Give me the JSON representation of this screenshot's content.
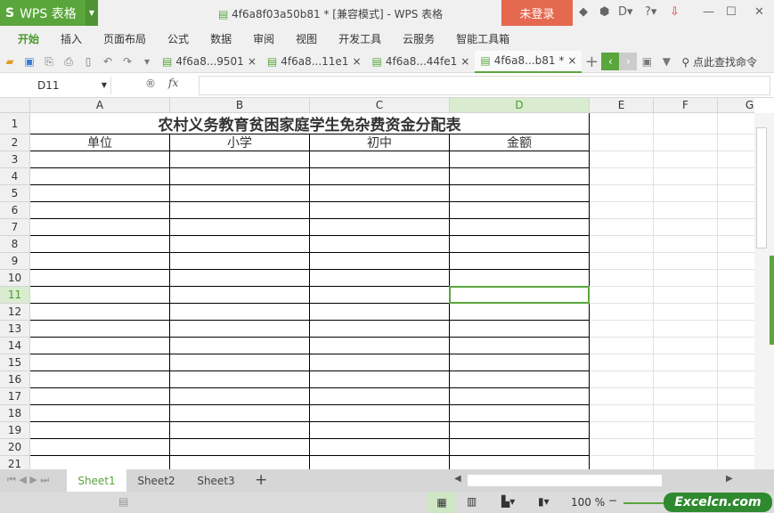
{
  "app": {
    "name": "WPS 表格",
    "title": "4f6a8f03a50b81 * [兼容模式] - WPS 表格",
    "login": "未登录"
  },
  "menu": [
    "开始",
    "插入",
    "页面布局",
    "公式",
    "数据",
    "审阅",
    "视图",
    "开发工具",
    "云服务",
    "智能工具箱"
  ],
  "doc_tabs": [
    {
      "label": "4f6a8...9501",
      "active": false
    },
    {
      "label": "4f6a8...11e1",
      "active": false
    },
    {
      "label": "4f6a8...44fe1",
      "active": false
    },
    {
      "label": "4f6a8...b81 *",
      "active": true
    }
  ],
  "search_label": "点此查找命令",
  "namebox": "D11",
  "fx": "fx",
  "columns": [
    "A",
    "B",
    "C",
    "D",
    "E",
    "F",
    "G"
  ],
  "selected_col": "D",
  "selected_row": 11,
  "rows": 21,
  "sheet": {
    "title": "农村义务教育贫困家庭学生免杂费资金分配表",
    "headers": [
      "单位",
      "小学",
      "初中",
      "金额"
    ]
  },
  "sheets": [
    "Sheet1",
    "Sheet2",
    "Sheet3"
  ],
  "active_sheet": "Sheet1",
  "zoom": "100 %",
  "watermark": "Excelcn.com",
  "accent": "#5aa63c"
}
